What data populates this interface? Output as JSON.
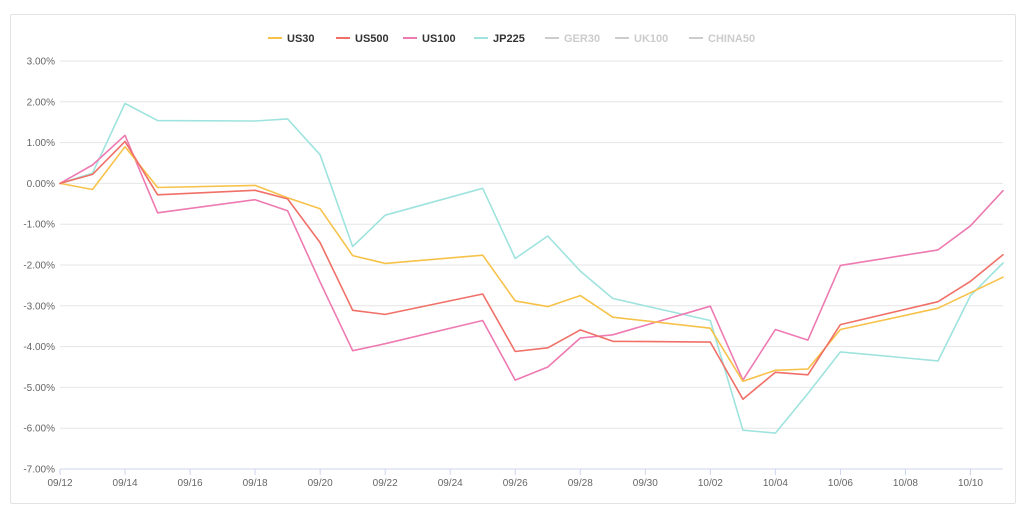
{
  "chart_data": {
    "type": "line",
    "title": "",
    "xlabel": "",
    "ylabel": "",
    "ylim": [
      -7,
      3
    ],
    "y_ticks": [
      3,
      2,
      1,
      0,
      -1,
      -2,
      -3,
      -4,
      -5,
      -6,
      -7
    ],
    "y_tick_labels": [
      "3.00%",
      "2.00%",
      "1.00%",
      "0.00%",
      "-1.00%",
      "-2.00%",
      "-3.00%",
      "-4.00%",
      "-5.00%",
      "-6.00%",
      "-7.00%"
    ],
    "x_tick_labels": [
      "09/12",
      "09/14",
      "09/16",
      "09/18",
      "09/20",
      "09/22",
      "09/24",
      "09/26",
      "09/28",
      "09/30",
      "10/02",
      "10/04",
      "10/06",
      "10/08",
      "10/10"
    ],
    "x_range": [
      "09/12",
      "10/11"
    ],
    "grid": "horizontal",
    "legend_position": "top-center",
    "x": [
      "09/12",
      "09/13",
      "09/14",
      "09/15",
      "09/18",
      "09/19",
      "09/20",
      "09/21",
      "09/22",
      "09/25",
      "09/26",
      "09/27",
      "09/28",
      "09/29",
      "10/02",
      "10/03",
      "10/04",
      "10/05",
      "10/06",
      "10/09",
      "10/10",
      "10/11"
    ],
    "series": [
      {
        "name": "US30",
        "color": "#f7c24a",
        "visible": true,
        "values": [
          0.0,
          -0.15,
          0.9,
          -0.1,
          -0.05,
          -0.35,
          -0.62,
          -1.77,
          -1.96,
          -1.76,
          -2.88,
          -3.02,
          -2.75,
          -3.28,
          -3.55,
          -4.85,
          -4.58,
          -4.55,
          -3.58,
          -3.06,
          -2.68,
          -2.3
        ]
      },
      {
        "name": "US500",
        "color": "#f07068",
        "visible": true,
        "values": [
          0.0,
          0.22,
          1.03,
          -0.28,
          -0.17,
          -0.38,
          -1.45,
          -3.11,
          -3.21,
          -2.71,
          -4.12,
          -4.03,
          -3.59,
          -3.87,
          -3.89,
          -5.29,
          -4.63,
          -4.69,
          -3.46,
          -2.9,
          -2.4,
          -1.75
        ]
      },
      {
        "name": "US100",
        "color": "#ee7ab2",
        "visible": true,
        "values": [
          0.0,
          0.45,
          1.18,
          -0.72,
          -0.4,
          -0.67,
          -2.42,
          -4.1,
          -3.93,
          -3.36,
          -4.82,
          -4.5,
          -3.79,
          -3.71,
          -3.01,
          -4.82,
          -3.58,
          -3.84,
          -2.01,
          -1.63,
          -1.04,
          -0.18
        ]
      },
      {
        "name": "JP225",
        "color": "#9fe3de",
        "visible": true,
        "values": [
          0.0,
          0.25,
          1.96,
          1.54,
          1.53,
          1.58,
          0.7,
          -1.55,
          -0.78,
          -0.12,
          -1.84,
          -1.29,
          -2.15,
          -2.82,
          -3.36,
          -6.05,
          -6.12,
          -5.15,
          -4.13,
          -4.35,
          -2.75,
          -1.95
        ]
      },
      {
        "name": "GER30",
        "color": "#cccccc",
        "visible": false,
        "values": []
      },
      {
        "name": "UK100",
        "color": "#cccccc",
        "visible": false,
        "values": []
      },
      {
        "name": "CHINA50",
        "color": "#cccccc",
        "visible": false,
        "values": []
      }
    ]
  }
}
